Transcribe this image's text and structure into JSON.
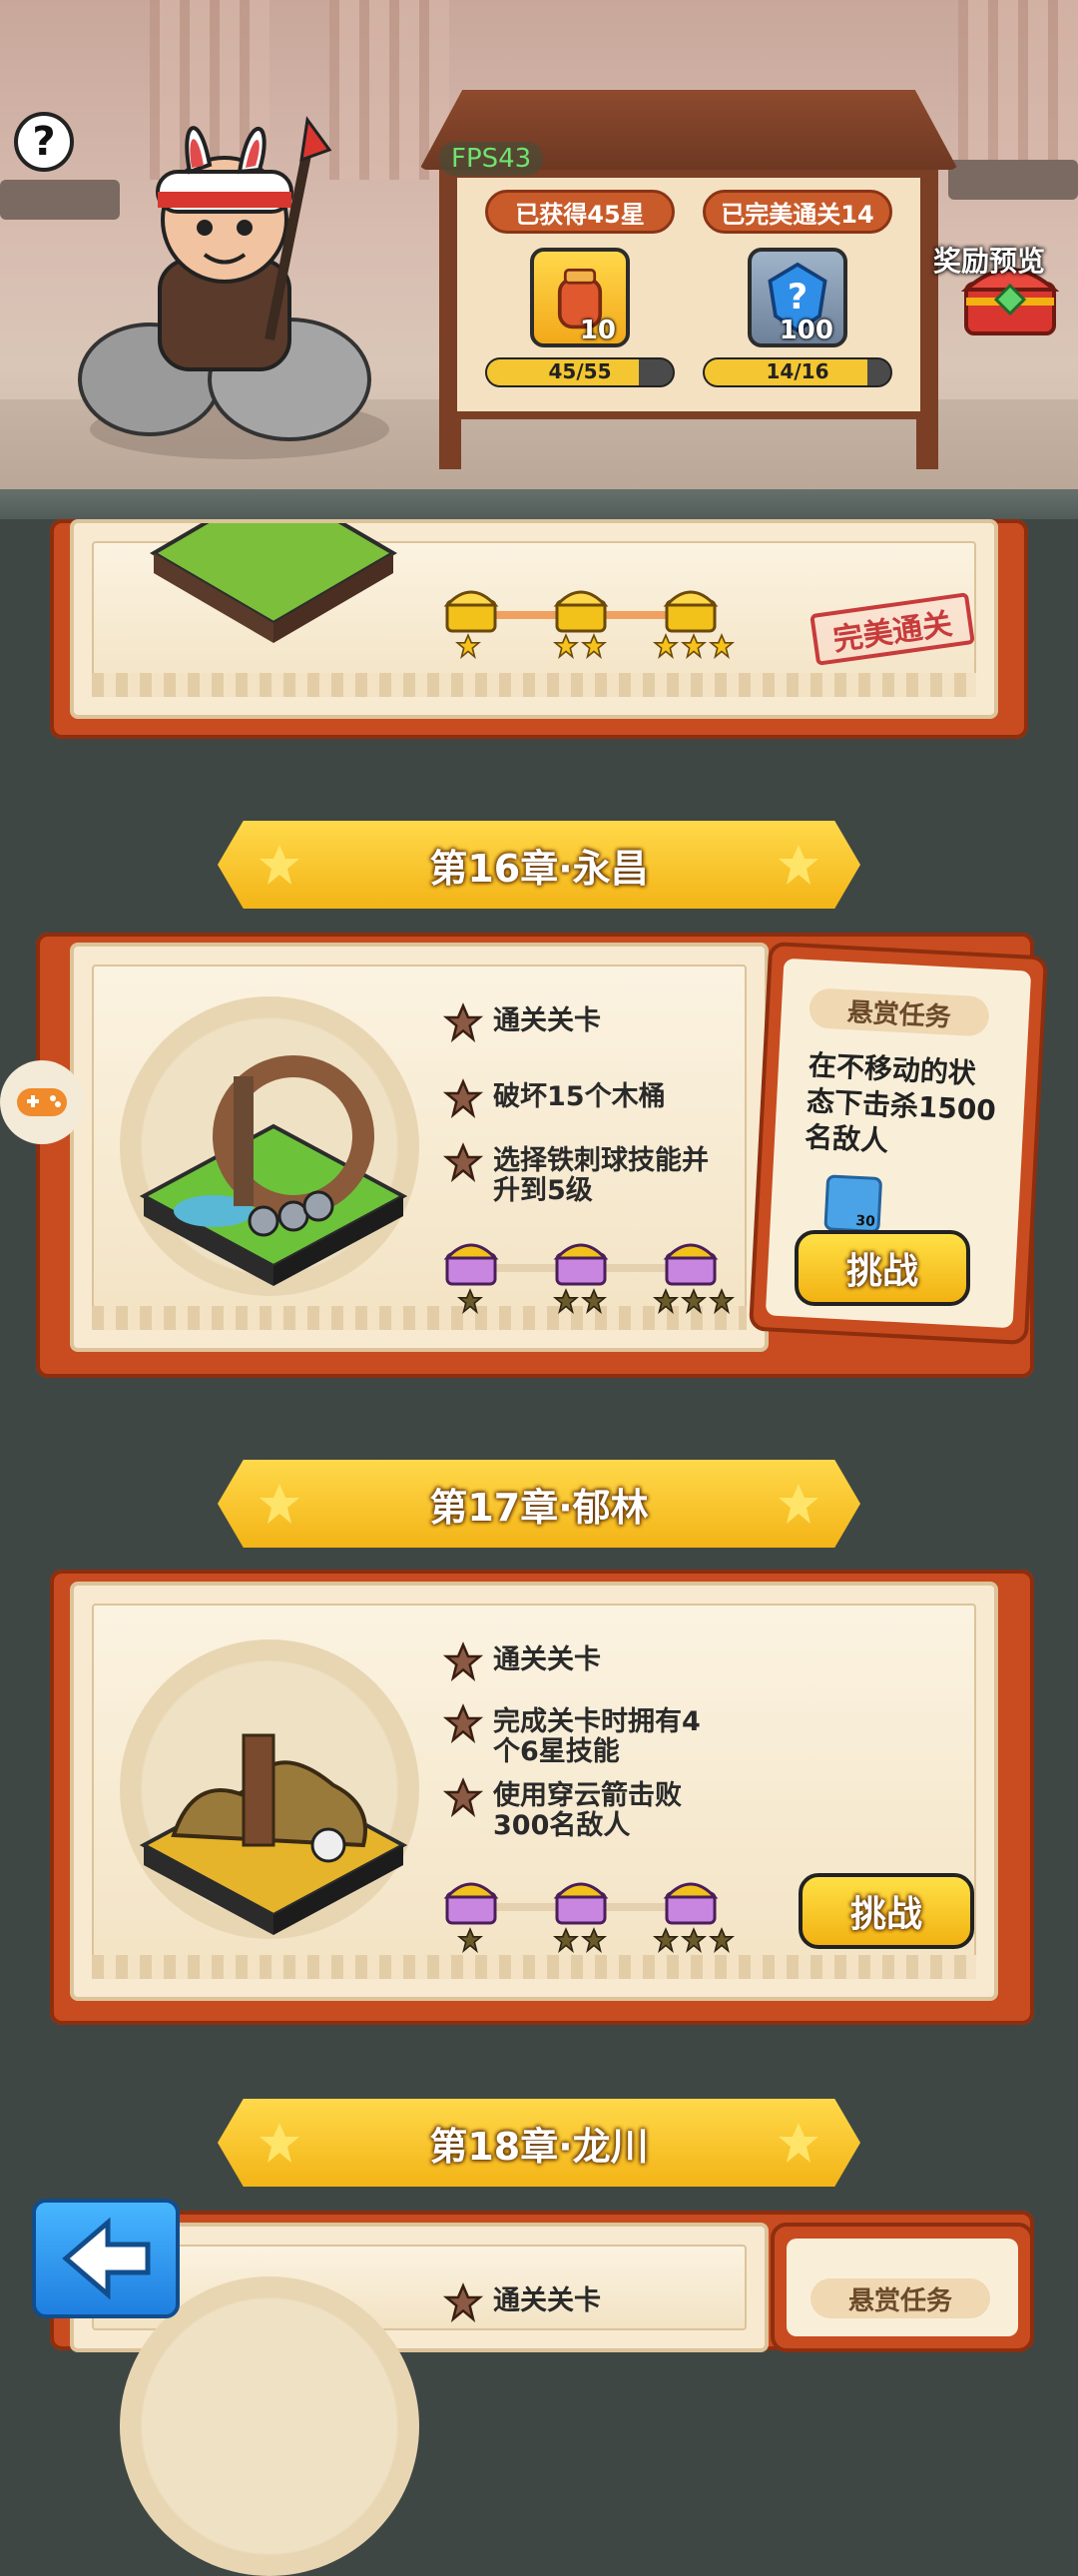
{
  "header": {
    "help_label": "?",
    "fps": "FPS43",
    "stars_title": "已获得45星",
    "stars_item_count": "10",
    "stars_progress_label": "45/55",
    "stars_progress": 0.818,
    "perfect_title": "已完美通关14",
    "perfect_item_count": "100",
    "perfect_progress_label": "14/16",
    "perfect_progress": 0.875,
    "reward_preview_label": "奖励预览"
  },
  "chapter15": {
    "stamp": "完美通关"
  },
  "chapter16": {
    "title": "第16章·永昌",
    "tasks": [
      "通关关卡",
      "破坏15个木桶",
      "选择铁刺球技能并升到5级"
    ],
    "bounty_head": "悬赏任务",
    "bounty_desc": "在不移动的状态下击杀1500名敌人",
    "bounty_hero_level": "30",
    "challenge_label": "挑战"
  },
  "chapter17": {
    "title": "第17章·郁林",
    "tasks": [
      "通关关卡",
      "完成关卡时拥有4个6星技能",
      "使用穿云箭击败300名敌人"
    ],
    "challenge_label": "挑战"
  },
  "chapter18": {
    "title": "第18章·龙川",
    "tasks": [
      "通关关卡"
    ],
    "bounty_head": "悬赏任务"
  },
  "colors": {
    "background": "#3f4744",
    "banner_gold": "#f3b416",
    "card_red": "#c84c1f",
    "button_yellow": "#ffd94a",
    "back_button_blue": "#1f7fe0"
  },
  "icons": [
    "help-icon",
    "hero-character",
    "jar-item-icon",
    "question-gem-icon",
    "treasure-chest-icon",
    "star-icon",
    "gamepad-icon",
    "back-arrow-icon"
  ]
}
